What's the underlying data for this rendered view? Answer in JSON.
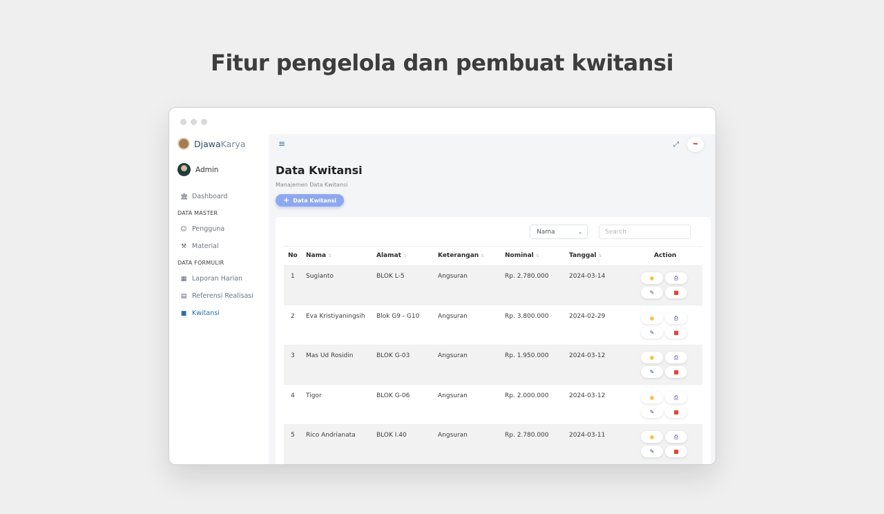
{
  "hero": {
    "title": "Fitur pengelola dan pembuat kwitansi"
  },
  "brand": {
    "part1": "Djawa",
    "part2": "Karya"
  },
  "user": {
    "name": "Admin"
  },
  "sidebar": {
    "dashboard": "Dashboard",
    "section_master": "DATA MASTER",
    "pengguna": "Pengguna",
    "material": "Material",
    "section_formulir": "DATA FORMULIR",
    "laporan": "Laporan Harian",
    "referensi": "Referensi Realisasi",
    "kwitansi": "Kwitansi"
  },
  "page": {
    "title": "Data Kwitansi",
    "subtitle": "Manajemen Data Kwitansi",
    "add_button": "Data Kwitansi"
  },
  "filter": {
    "selected": "Nama",
    "search_placeholder": "Search"
  },
  "table": {
    "headers": {
      "no": "No",
      "nama": "Nama",
      "alamat": "Alamat",
      "keterangan": "Keterangan",
      "nominal": "Nominal",
      "tanggal": "Tanggal",
      "action": "Action"
    },
    "rows": [
      {
        "no": "1",
        "nama": "Sugianto",
        "alamat": "BLOK L-5",
        "keterangan": "Angsuran",
        "nominal": "Rp. 2.780.000",
        "tanggal": "2024-03-14"
      },
      {
        "no": "2",
        "nama": "Eva Kristiyaningsih",
        "alamat": "Blok G9 - G10",
        "keterangan": "Angsuran",
        "nominal": "Rp. 3.800.000",
        "tanggal": "2024-02-29"
      },
      {
        "no": "3",
        "nama": "Mas Ud Rosidin",
        "alamat": "BLOK G-03",
        "keterangan": "Angsuran",
        "nominal": "Rp. 1.950.000",
        "tanggal": "2024-03-12"
      },
      {
        "no": "4",
        "nama": "Tigor",
        "alamat": "BLOK G-06",
        "keterangan": "Angsuran",
        "nominal": "Rp. 2.000.000",
        "tanggal": "2024-03-12"
      },
      {
        "no": "5",
        "nama": "Rico Andrianata",
        "alamat": "BLOK I.40",
        "keterangan": "Angsuran",
        "nominal": "Rp. 2.780.000",
        "tanggal": "2024-03-11"
      }
    ]
  },
  "colors": {
    "accent": "#2c6fa8",
    "add_button": "#8ea8f0",
    "view": "#f3b52a",
    "delete": "#e0473b"
  },
  "icons": [
    "menu-icon",
    "expand-icon",
    "logout-icon",
    "bank-icon",
    "users-icon",
    "tools-icon",
    "calendar-icon",
    "clipboard-icon",
    "note-icon",
    "plus-icon",
    "eye-icon",
    "printer-icon",
    "edit-icon",
    "trash-icon",
    "sort-icon",
    "chevron-down-icon"
  ]
}
